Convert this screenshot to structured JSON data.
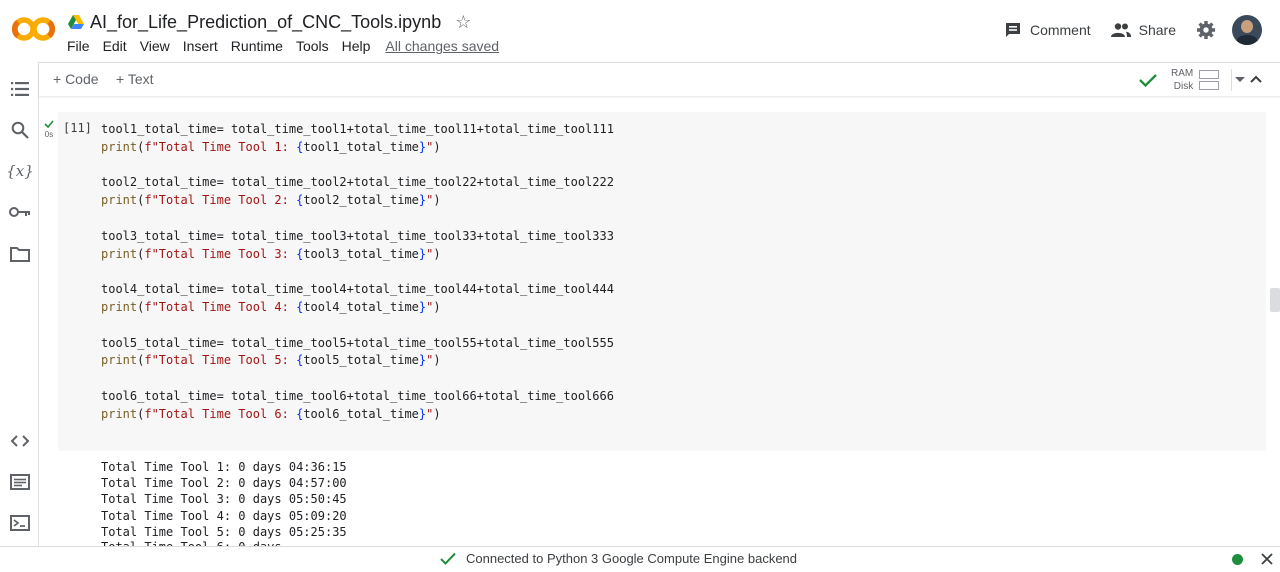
{
  "header": {
    "notebook_title": "AI_for_Life_Prediction_of_CNC_Tools.ipynb",
    "menu": [
      "File",
      "Edit",
      "View",
      "Insert",
      "Runtime",
      "Tools",
      "Help"
    ],
    "save_status": "All changes saved",
    "comment_label": "Comment",
    "share_label": "Share"
  },
  "toolbar": {
    "add_code_label": "+ Code",
    "add_text_label": "+ Text",
    "ram_label": "RAM",
    "disk_label": "Disk"
  },
  "cell": {
    "exec_count": "[11]",
    "run_time": "0s",
    "code_lines": [
      {
        "var": "tool1_total_time",
        "expr": "total_time_tool1+total_time_tool11+total_time_tool111",
        "print_str": "\"Total Time Tool 1: ",
        "print_var": "tool1_total_time"
      },
      {
        "var": "tool2_total_time",
        "expr": "total_time_tool2+total_time_tool22+total_time_tool222",
        "print_str": "\"Total Time Tool 2: ",
        "print_var": "tool2_total_time"
      },
      {
        "var": "tool3_total_time",
        "expr": "total_time_tool3+total_time_tool33+total_time_tool333",
        "print_str": "\"Total Time Tool 3: ",
        "print_var": "tool3_total_time"
      },
      {
        "var": "tool4_total_time",
        "expr": "total_time_tool4+total_time_tool44+total_time_tool444",
        "print_str": "\"Total Time Tool 4: ",
        "print_var": "tool4_total_time"
      },
      {
        "var": "tool5_total_time",
        "expr": "total_time_tool5+total_time_tool55+total_time_tool555",
        "print_str": "\"Total Time Tool 5: ",
        "print_var": "tool5_total_time"
      },
      {
        "var": "tool6_total_time",
        "expr": "total_time_tool6+total_time_tool66+total_time_tool666",
        "print_str": "\"Total Time Tool 6: ",
        "print_var": "tool6_total_time"
      }
    ],
    "output_lines": [
      "Total Time Tool 1: 0 days 04:36:15",
      "Total Time Tool 2: 0 days 04:57:00",
      "Total Time Tool 3: 0 days 05:50:45",
      "Total Time Tool 4: 0 days 05:09:20",
      "Total Time Tool 5: 0 days 05:25:35"
    ],
    "output_partial": "Total Time Tool 6: 0 days"
  },
  "status": {
    "text": "Connected to Python 3 Google Compute Engine backend",
    "connected_color": "#1e8e3e"
  },
  "colors": {
    "brand_orange": "#f9ab00",
    "check_green": "#1e8e3e"
  }
}
